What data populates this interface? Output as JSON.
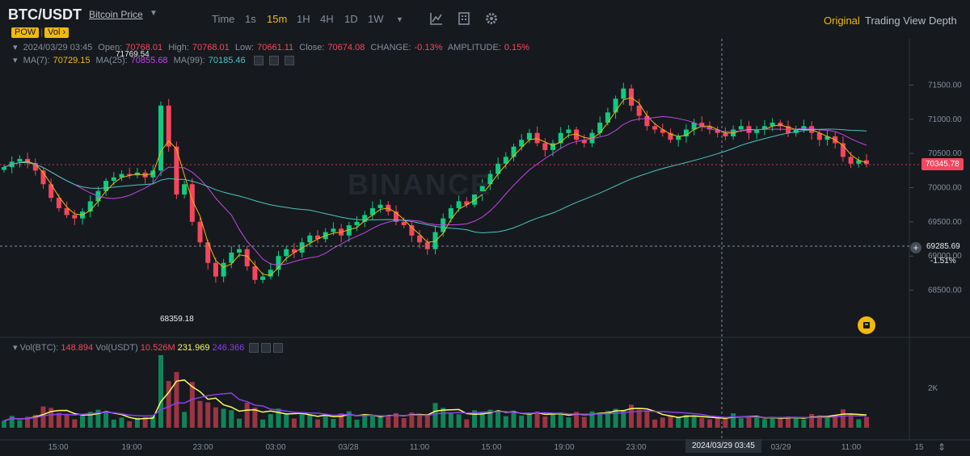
{
  "header": {
    "pair": "BTC/USDT",
    "price_link": "Bitcoin Price",
    "timeframes": [
      "Time",
      "1s",
      "15m",
      "1H",
      "4H",
      "1D",
      "1W"
    ],
    "active_timeframe": "15m",
    "views": [
      "Original",
      "Trading View",
      "Depth"
    ],
    "active_view": "Original",
    "icons": [
      "dropdown-caret-icon",
      "indicator-icon",
      "layout-icon",
      "settings-icon"
    ]
  },
  "chips": {
    "pow": "POW",
    "vol": "Vol ›"
  },
  "ohlc": {
    "date": "2024/03/29 03:45",
    "open_label": "Open:",
    "open": "70768.01",
    "high_label": "High:",
    "high": "70768.01",
    "low_label": "Low:",
    "low": "70661.11",
    "close_label": "Close:",
    "close": "70674.08",
    "change_label": "CHANGE:",
    "change": "-0.13%",
    "amplitude_label": "AMPLITUDE:",
    "amplitude": "0.15%"
  },
  "ma": {
    "ma7_label": "MA(7):",
    "ma7": "70729.15",
    "ma25_label": "MA(25):",
    "ma25": "70855.68",
    "ma99_label": "MA(99):",
    "ma99": "70185.46"
  },
  "volume": {
    "vol_btc_label": "Vol(BTC):",
    "vol_btc": "148.894",
    "vol_usdt_label": "Vol(USDT)",
    "vol_usdt": "10.526M",
    "ma1": "231.969",
    "ma2": "246.366",
    "axis_label": "2K"
  },
  "price_axis": [
    "71500.00",
    "71000.00",
    "70500.00",
    "70000.00",
    "69500.00",
    "69000.00",
    "68500.00"
  ],
  "time_axis": [
    "15:00",
    "19:00",
    "23:00",
    "03:00",
    "03/28",
    "11:00",
    "15:00",
    "19:00",
    "23:00",
    "03/29",
    "11:00",
    "15"
  ],
  "current_price": "70345.78",
  "crosshair": {
    "price": "69285.69",
    "pct": "-1.51%",
    "time": "2024/03/29 03:45"
  },
  "high_marker": "71769.54",
  "low_marker": "68359.18",
  "watermark": "BINANCE",
  "colors": {
    "up": "#0ecb81",
    "down": "#f6465d",
    "ma7": "#f0b90b",
    "ma25": "#c545e8",
    "ma99": "#4fc2c2",
    "accent": "#f0b90b",
    "vol_ma1": "#fcfc5c",
    "vol_ma2": "#8a3ff2"
  },
  "chart_data": {
    "type": "candlestick",
    "interval": "15m",
    "ylim": [
      68200,
      71800
    ],
    "closes": [
      70300,
      70380,
      70420,
      70360,
      70250,
      70050,
      69850,
      69700,
      69600,
      69550,
      69650,
      69800,
      69950,
      70100,
      70150,
      70200,
      70180,
      70220,
      70150,
      70250,
      71200,
      70600,
      69900,
      70050,
      69500,
      69200,
      68900,
      68700,
      68900,
      69050,
      69100,
      68850,
      68650,
      68700,
      68800,
      69000,
      69100,
      69050,
      69200,
      69300,
      69250,
      69350,
      69400,
      69300,
      69450,
      69500,
      69600,
      69700,
      69750,
      69650,
      69500,
      69450,
      69300,
      69200,
      69100,
      69350,
      69550,
      69700,
      69800,
      69750,
      69900,
      70050,
      70200,
      70350,
      70450,
      70600,
      70700,
      70800,
      70650,
      70550,
      70650,
      70800,
      70850,
      70700,
      70650,
      70800,
      70950,
      71100,
      71300,
      71450,
      71200,
      71050,
      70900,
      70850,
      70800,
      70700,
      70750,
      70850,
      70950,
      70900,
      70850,
      70800,
      70750,
      70850,
      70900,
      70800,
      70850,
      70900,
      70950,
      70900,
      70800,
      70850,
      70900,
      70800,
      70700,
      70750,
      70650,
      70450,
      70350,
      70400,
      70345
    ],
    "volume_ma_series": [
      "MA1",
      "MA2"
    ]
  }
}
